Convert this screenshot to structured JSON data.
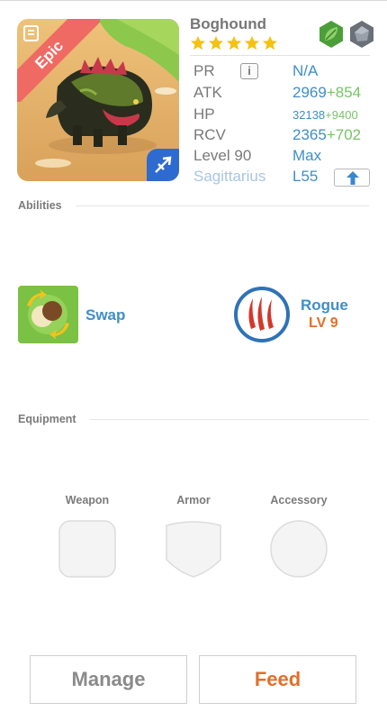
{
  "monster": {
    "name": "Boghound",
    "rarity": "Epic",
    "stars": 5,
    "elements": [
      "leaf-element-icon",
      "stone-element-icon"
    ]
  },
  "stats": {
    "pr": {
      "label": "PR",
      "value": "N/A",
      "info_icon": "i"
    },
    "atk": {
      "label": "ATK",
      "value": "2969",
      "bonus": "+854"
    },
    "hp": {
      "label": "HP",
      "value": "32138",
      "bonus": "+9400"
    },
    "rcv": {
      "label": "RCV",
      "value": "2365",
      "bonus": "+702"
    },
    "level": {
      "label": "Level 90",
      "value": "Max"
    },
    "zodiac": {
      "label": "Sagittarius",
      "value": "L55"
    }
  },
  "abilities": {
    "title": "Abilities",
    "skill": {
      "name": "Swap",
      "icon": "swap-icon"
    },
    "trait": {
      "name": "Rogue",
      "level": "LV 9",
      "icon": "claw-icon"
    }
  },
  "equipment": {
    "title": "Equipment",
    "slots": [
      {
        "label": "Weapon",
        "icon": "weapon-slot-icon"
      },
      {
        "label": "Armor",
        "icon": "armor-slot-icon"
      },
      {
        "label": "Accessory",
        "icon": "accessory-slot-icon"
      }
    ]
  },
  "buttons": {
    "manage": "Manage",
    "feed": "Feed"
  },
  "colors": {
    "accent_blue": "#3f8ec8",
    "bonus_green": "#76c466",
    "feed_orange": "#e0702a",
    "epic_red": "#ef6a62"
  }
}
